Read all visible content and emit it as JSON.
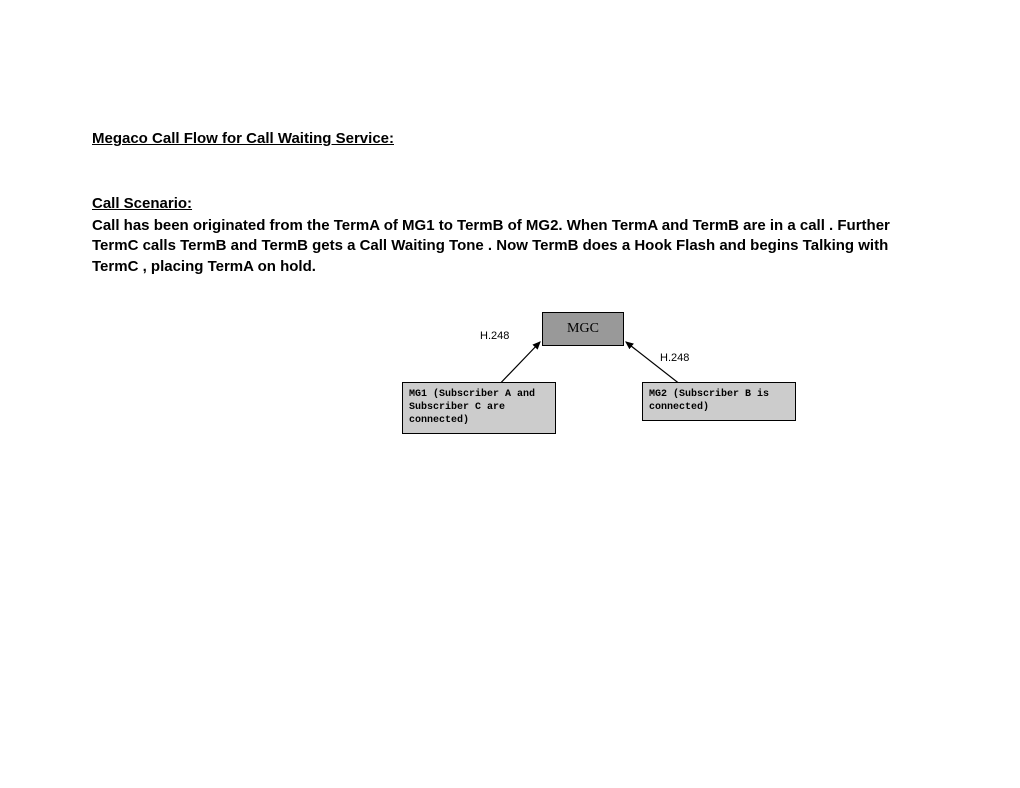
{
  "title": "Megaco Call Flow for Call Waiting Service:",
  "scenario": {
    "label": "Call Scenario:",
    "text": "Call has been originated from the TermA of MG1 to TermB of MG2. When TermA and TermB are in a call . Further TermC calls TermB and TermB gets a Call Waiting Tone . Now TermB does a Hook Flash and begins Talking with TermC , placing TermA on hold."
  },
  "diagram": {
    "mgc_label": "MGC",
    "label_left": "H.248",
    "label_right": "H.248",
    "mg1_text": "MG1 (Subscriber A and Subscriber C are connected)",
    "mg2_text": "MG2 (Subscriber B is connected)"
  }
}
